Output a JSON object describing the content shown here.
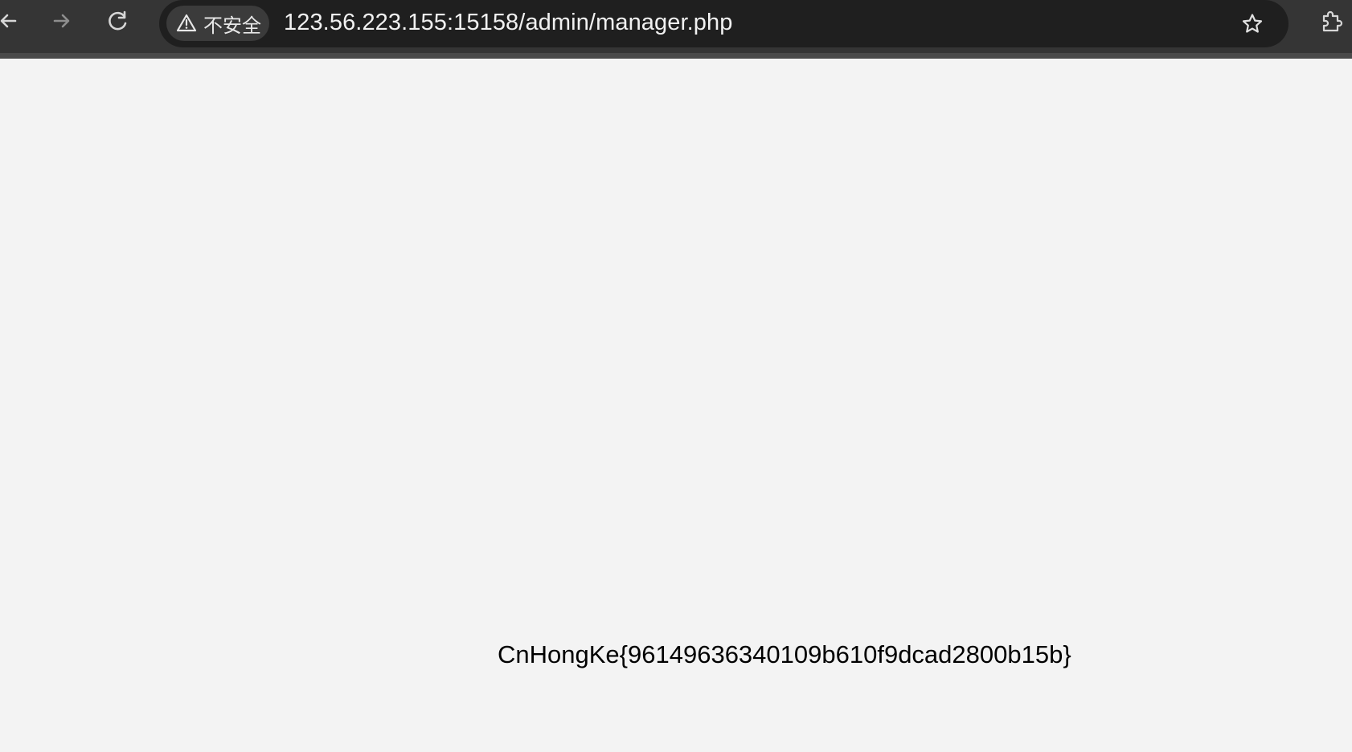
{
  "browser": {
    "url": "123.56.223.155:15158/admin/manager.php",
    "security_label": "不安全",
    "icons": {
      "back": "arrow-left-icon",
      "forward": "arrow-right-icon",
      "reload": "reload-icon",
      "security": "warning-triangle-icon",
      "bookmark": "star-outline-icon",
      "extensions": "puzzle-icon"
    },
    "colors": {
      "toolbar": "#353535",
      "omnibox": "#1f1f1f",
      "security_chip": "#3b3b3b",
      "page_background": "#f3f3f3"
    }
  },
  "page": {
    "flag": "CnHongKe{96149636340109b610f9dcad2800b15b}"
  }
}
